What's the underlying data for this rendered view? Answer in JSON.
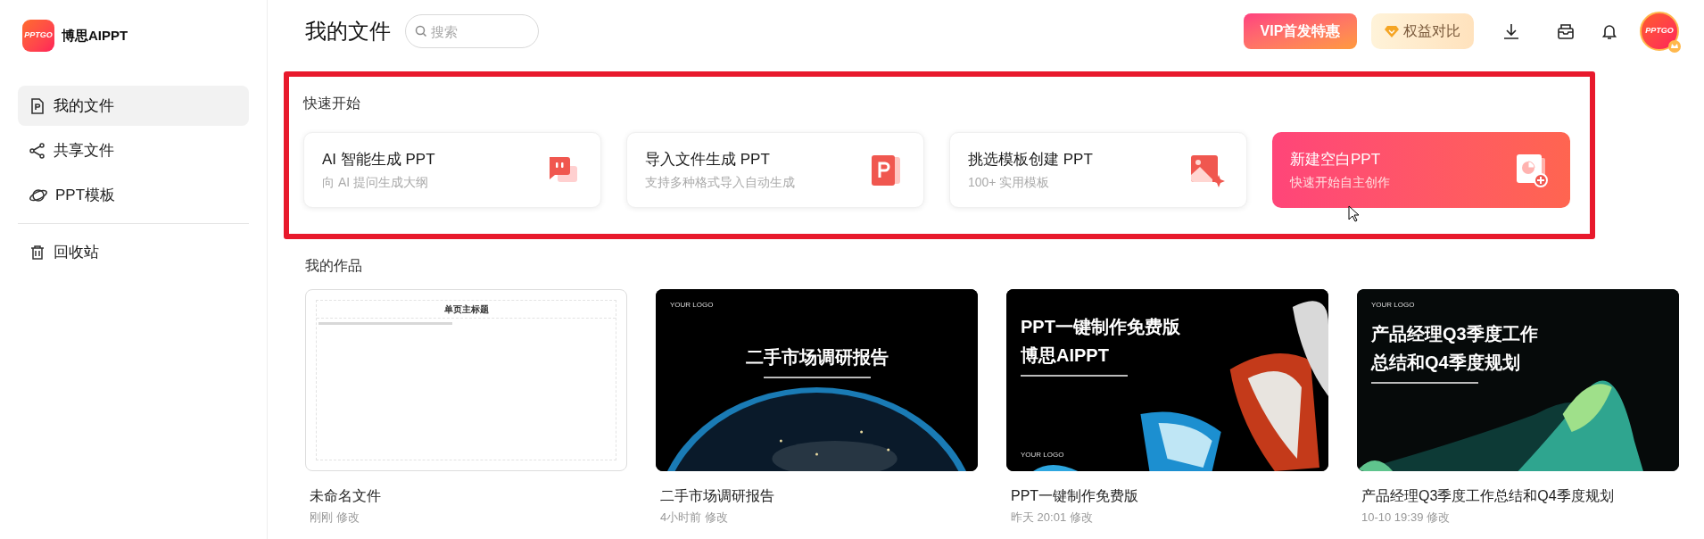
{
  "sidebar": {
    "logo_text": "PPTGO",
    "brand": "博思AIPPT",
    "items": [
      {
        "label": "我的文件",
        "selected": true
      },
      {
        "label": "共享文件",
        "selected": false
      },
      {
        "label": "PPT模板",
        "selected": false
      }
    ],
    "bottom_items": [
      {
        "label": "回收站",
        "selected": false
      }
    ]
  },
  "header": {
    "title": "我的文件",
    "search": {
      "placeholder": "搜索"
    },
    "vip_button": "VIP首发特惠",
    "benefits_button": "权益对比",
    "avatar_text": "PPTGO"
  },
  "quick_start": {
    "title": "快速开始",
    "cards": [
      {
        "title": "AI 智能生成 PPT",
        "subtitle": "向 AI 提问生成大纲",
        "hovered": false
      },
      {
        "title": "导入文件生成 PPT",
        "subtitle": "支持多种格式导入自动生成",
        "hovered": false
      },
      {
        "title": "挑选模板创建 PPT",
        "subtitle": "100+ 实用模板",
        "hovered": false
      },
      {
        "title": "新建空白PPT",
        "subtitle": "快速开始自主创作",
        "hovered": true
      }
    ]
  },
  "works": {
    "title": "我的作品",
    "items": [
      {
        "kind": "blank",
        "slide_title": "单页主标题",
        "name": "未命名文件",
        "modified": "刚刚 修改"
      },
      {
        "kind": "earth",
        "slide_logo": "YOUR LOGO",
        "slide_title": "二手市场调研报告",
        "name": "二手市场调研报告",
        "modified": "4小时前 修改"
      },
      {
        "kind": "glass",
        "slide_logo": "YOUR LOGO",
        "slide_title": "PPT一键制作免费版",
        "slide_subtitle": "博思AIPPT",
        "name": "PPT一键制作免费版",
        "modified": "昨天 20:01 修改"
      },
      {
        "kind": "wave",
        "slide_logo": "YOUR LOGO",
        "slide_title": "产品经理Q3季度工作",
        "slide_subtitle": "总结和Q4季度规划",
        "name": "产品经理Q3季度工作总结和Q4季度规划",
        "modified": "10-10 19:39 修改"
      }
    ]
  }
}
